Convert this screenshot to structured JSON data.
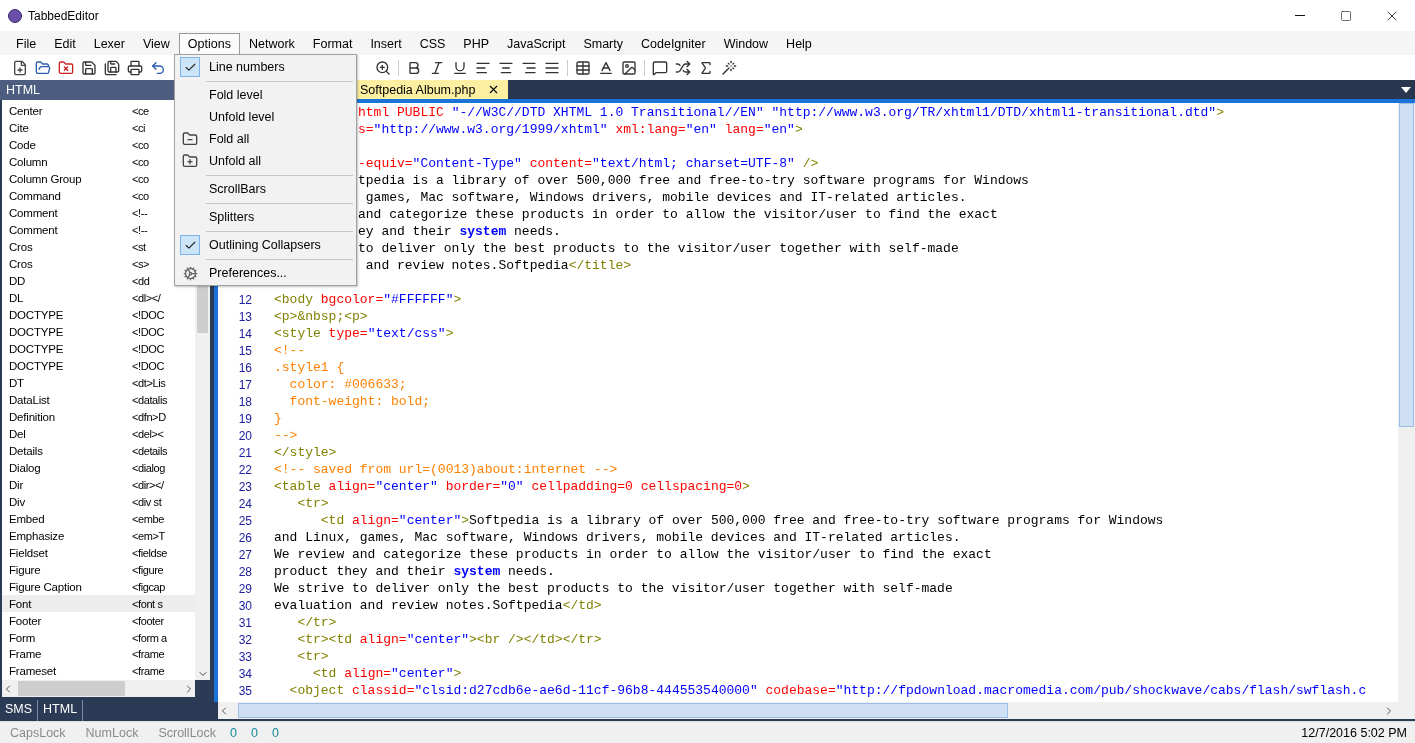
{
  "window": {
    "title": "TabbedEditor"
  },
  "menu_bar": [
    {
      "label": "File",
      "selected": false
    },
    {
      "label": "Edit",
      "selected": false
    },
    {
      "label": "Lexer",
      "selected": false
    },
    {
      "label": "View",
      "selected": false
    },
    {
      "label": "Options",
      "selected": true
    },
    {
      "label": "Network",
      "selected": false
    },
    {
      "label": "Format",
      "selected": false
    },
    {
      "label": "Insert",
      "selected": false
    },
    {
      "label": "CSS",
      "selected": false
    },
    {
      "label": "PHP",
      "selected": false
    },
    {
      "label": "JavaScript",
      "selected": false
    },
    {
      "label": "Smarty",
      "selected": false
    },
    {
      "label": "CodeIgniter",
      "selected": false
    },
    {
      "label": "Window",
      "selected": false
    },
    {
      "label": "Help",
      "selected": false
    }
  ],
  "options_menu": [
    {
      "kind": "check",
      "label": "Line numbers",
      "checked": true
    },
    {
      "kind": "separator"
    },
    {
      "kind": "plain",
      "label": "Fold level"
    },
    {
      "kind": "plain",
      "label": "Unfold level"
    },
    {
      "kind": "fold",
      "label": "Fold all"
    },
    {
      "kind": "unfold",
      "label": "Unfold all"
    },
    {
      "kind": "separator"
    },
    {
      "kind": "check",
      "label": "ScrollBars",
      "checked": false
    },
    {
      "kind": "separator"
    },
    {
      "kind": "check",
      "label": "Splitters",
      "checked": false
    },
    {
      "kind": "separator"
    },
    {
      "kind": "check",
      "label": "Outlining Collapsers",
      "checked": true
    },
    {
      "kind": "separator"
    },
    {
      "kind": "settings",
      "label": "Preferences..."
    }
  ],
  "side_panel": {
    "title": "HTML",
    "items": [
      {
        "name": "Center",
        "snippet": "<ce",
        "selected": false
      },
      {
        "name": "Cite",
        "snippet": "<ci",
        "selected": false
      },
      {
        "name": "Code",
        "snippet": "<co",
        "selected": false
      },
      {
        "name": "Column",
        "snippet": "<co",
        "selected": false
      },
      {
        "name": "Column Group",
        "snippet": "<co",
        "selected": false
      },
      {
        "name": "Command",
        "snippet": "<co",
        "selected": false
      },
      {
        "name": "Comment",
        "snippet": "<!--",
        "selected": false
      },
      {
        "name": "Comment",
        "snippet": "<!--",
        "selected": false
      },
      {
        "name": "Cros",
        "snippet": "<st",
        "selected": false
      },
      {
        "name": "Cros",
        "snippet": "<s>",
        "selected": false
      },
      {
        "name": "DD",
        "snippet": "<dd",
        "selected": false
      },
      {
        "name": "DL",
        "snippet": "<dl></",
        "selected": false
      },
      {
        "name": "DOCTYPE",
        "snippet": "<!DOC",
        "selected": false
      },
      {
        "name": "DOCTYPE",
        "snippet": "<!DOC",
        "selected": false
      },
      {
        "name": "DOCTYPE",
        "snippet": "<!DOC",
        "selected": false
      },
      {
        "name": "DOCTYPE",
        "snippet": "<!DOC",
        "selected": false
      },
      {
        "name": "DT",
        "snippet": "<dt>Lis",
        "selected": false
      },
      {
        "name": "DataList",
        "snippet": "<datalis",
        "selected": false
      },
      {
        "name": "Definition",
        "snippet": "<dfn>D",
        "selected": false
      },
      {
        "name": "Del",
        "snippet": "<del><",
        "selected": false
      },
      {
        "name": "Details",
        "snippet": "<details",
        "selected": false
      },
      {
        "name": "Dialog",
        "snippet": "<dialog",
        "selected": false
      },
      {
        "name": "Dir",
        "snippet": "<dir></",
        "selected": false
      },
      {
        "name": "Div",
        "snippet": "<div st",
        "selected": false
      },
      {
        "name": "Embed",
        "snippet": "<embe",
        "selected": false
      },
      {
        "name": "Emphasize",
        "snippet": "<em>T",
        "selected": false
      },
      {
        "name": "Fieldset",
        "snippet": "<fieldse",
        "selected": false
      },
      {
        "name": "Figure",
        "snippet": "<figure",
        "selected": false
      },
      {
        "name": "Figure Caption",
        "snippet": "<figcap",
        "selected": false
      },
      {
        "name": "Font",
        "snippet": "<font s",
        "selected": true
      },
      {
        "name": "Footer",
        "snippet": "<footer",
        "selected": false
      },
      {
        "name": "Form",
        "snippet": "<form a",
        "selected": false
      },
      {
        "name": "Frame",
        "snippet": "<frame",
        "selected": false
      },
      {
        "name": "Frameset",
        "snippet": "<frame",
        "selected": false
      }
    ],
    "tabs": [
      {
        "label": "SMS"
      },
      {
        "label": "HTML"
      }
    ]
  },
  "editor": {
    "tab": {
      "label": "Softpedia Album.php"
    },
    "lines": [
      {
        "cut_left": true,
        "segments": [
          {
            "kind": "attr",
            "text": "html PUBLIC"
          },
          {
            "kind": "value",
            "text": " \"-//W3C//DTD XHTML 1.0 Transitional//EN\" \"http://www.w3.org/TR/xhtml1/DTD/xhtml1-transitional.dtd\""
          },
          {
            "kind": "tag",
            "text": ">"
          }
        ]
      },
      {
        "cut_left": true,
        "segments": [
          {
            "kind": "attr",
            "text": "s="
          },
          {
            "kind": "value",
            "text": "\"http://www.w3.org/1999/xhtml\""
          },
          {
            "kind": "attr",
            "text": " xml:lang="
          },
          {
            "kind": "value",
            "text": "\"en\""
          },
          {
            "kind": "attr",
            "text": " lang="
          },
          {
            "kind": "value",
            "text": "\"en\""
          },
          {
            "kind": "tag",
            "text": ">"
          }
        ]
      },
      {
        "kind": "blank"
      },
      {
        "cut_left": true,
        "segments": [
          {
            "kind": "attr",
            "text": "-equiv="
          },
          {
            "kind": "value",
            "text": "\"Content-Type\""
          },
          {
            "kind": "attr",
            "text": " content="
          },
          {
            "kind": "value",
            "text": "\"text/html; charset=UTF-8\""
          },
          {
            "kind": "tag",
            "text": " />"
          }
        ]
      },
      {
        "cut_left": true,
        "segments": [
          {
            "kind": "text",
            "text": "tpedia is a library of over 500,000 free and free-to-try software programs for Windows"
          }
        ]
      },
      {
        "cut_left": true,
        "segments": [
          {
            "kind": "text",
            "text": " games, Mac software, Windows drivers, mobile devices and IT-related articles."
          }
        ]
      },
      {
        "cut_left": true,
        "segments": [
          {
            "kind": "text",
            "text": "and categorize these products in order to allow the visitor/user to find the exact"
          }
        ]
      },
      {
        "cut_left": true,
        "segments": [
          {
            "kind": "text",
            "text": "ey and their "
          },
          {
            "kind": "keyword",
            "text": "system"
          },
          {
            "kind": "text",
            "text": " needs."
          }
        ]
      },
      {
        "cut_left": true,
        "segments": [
          {
            "kind": "text",
            "text": "to deliver only the best products to the visitor/user together with self-made"
          }
        ]
      },
      {
        "cut_left": true,
        "segments": [
          {
            "kind": "text",
            "text": " and review notes.Softpedia"
          },
          {
            "kind": "tag",
            "text": "</title>"
          }
        ]
      },
      {
        "kind": "blank"
      },
      {
        "number": "12",
        "segments": [
          {
            "kind": "tag",
            "text": "<body"
          },
          {
            "kind": "attr",
            "text": " bgcolor="
          },
          {
            "kind": "value",
            "text": "\"#FFFFFF\""
          },
          {
            "kind": "tag",
            "text": ">"
          }
        ]
      },
      {
        "number": "13",
        "segments": [
          {
            "kind": "tag",
            "text": "<p>&nbsp;<p>"
          }
        ]
      },
      {
        "number": "14",
        "segments": [
          {
            "kind": "tag",
            "text": "<style"
          },
          {
            "kind": "attr",
            "text": " type="
          },
          {
            "kind": "value",
            "text": "\"text/css\""
          },
          {
            "kind": "tag",
            "text": ">"
          }
        ]
      },
      {
        "number": "15",
        "segments": [
          {
            "kind": "css",
            "text": "<!--"
          }
        ]
      },
      {
        "number": "16",
        "segments": [
          {
            "kind": "css",
            "text": ".style1 {"
          }
        ]
      },
      {
        "number": "17",
        "segments": [
          {
            "kind": "css",
            "text": "  color: #006633;"
          }
        ]
      },
      {
        "number": "18",
        "segments": [
          {
            "kind": "css",
            "text": "  font-weight: bold;"
          }
        ]
      },
      {
        "number": "19",
        "segments": [
          {
            "kind": "css",
            "text": "}"
          }
        ]
      },
      {
        "number": "20",
        "segments": [
          {
            "kind": "css",
            "text": "-->"
          }
        ]
      },
      {
        "number": "21",
        "segments": [
          {
            "kind": "tag",
            "text": "</style>"
          }
        ]
      },
      {
        "number": "22",
        "segments": [
          {
            "kind": "css",
            "text": "<!-- saved from url=(0013)about:internet -->"
          }
        ]
      },
      {
        "number": "23",
        "segments": [
          {
            "kind": "tag",
            "text": "<table"
          },
          {
            "kind": "attr",
            "text": " align="
          },
          {
            "kind": "value",
            "text": "\"center\""
          },
          {
            "kind": "attr",
            "text": " border="
          },
          {
            "kind": "value",
            "text": "\"0\""
          },
          {
            "kind": "attr",
            "text": " cellpadding=0 cellspacing=0"
          },
          {
            "kind": "tag",
            "text": ">"
          }
        ]
      },
      {
        "number": "24",
        "segments": [
          {
            "kind": "tag",
            "text": "   <tr>"
          }
        ]
      },
      {
        "number": "25",
        "segments": [
          {
            "kind": "tag",
            "text": "      <td"
          },
          {
            "kind": "attr",
            "text": " align="
          },
          {
            "kind": "value",
            "text": "\"center\""
          },
          {
            "kind": "tag",
            "text": ">"
          },
          {
            "kind": "text",
            "text": "Softpedia is a library of over 500,000 free and free-to-try software programs for Windows"
          }
        ]
      },
      {
        "number": "26",
        "segments": [
          {
            "kind": "text",
            "text": "and Linux, games, Mac software, Windows drivers, mobile devices and IT-related articles."
          }
        ]
      },
      {
        "number": "27",
        "segments": [
          {
            "kind": "text",
            "text": "We review and categorize these products in order to allow the visitor/user to find the exact"
          }
        ]
      },
      {
        "number": "28",
        "segments": [
          {
            "kind": "text",
            "text": "product they and their "
          },
          {
            "kind": "keyword",
            "text": "system"
          },
          {
            "kind": "text",
            "text": " needs."
          }
        ]
      },
      {
        "number": "29",
        "segments": [
          {
            "kind": "text",
            "text": "We strive to deliver only the best products to the visitor/user together with self-made"
          }
        ]
      },
      {
        "number": "30",
        "segments": [
          {
            "kind": "text",
            "text": "evaluation and review notes.Softpedia"
          },
          {
            "kind": "tag",
            "text": "</td>"
          }
        ]
      },
      {
        "number": "31",
        "segments": [
          {
            "kind": "tag",
            "text": "   </tr>"
          }
        ]
      },
      {
        "number": "32",
        "segments": [
          {
            "kind": "tag",
            "text": "   <tr><td"
          },
          {
            "kind": "attr",
            "text": " align="
          },
          {
            "kind": "value",
            "text": "\"center\""
          },
          {
            "kind": "tag",
            "text": "><br /></td></tr>"
          }
        ]
      },
      {
        "number": "33",
        "segments": [
          {
            "kind": "tag",
            "text": "   <tr>"
          }
        ]
      },
      {
        "number": "34",
        "segments": [
          {
            "kind": "tag",
            "text": "     <td"
          },
          {
            "kind": "attr",
            "text": " align="
          },
          {
            "kind": "value",
            "text": "\"center\""
          },
          {
            "kind": "tag",
            "text": ">"
          }
        ]
      },
      {
        "number": "35",
        "segments": [
          {
            "kind": "tag",
            "text": "  <object"
          },
          {
            "kind": "attr",
            "text": " classid="
          },
          {
            "kind": "value",
            "text": "\"clsid:d27cdb6e-ae6d-11cf-96b8-444553540000\""
          },
          {
            "kind": "attr",
            "text": " codebase="
          },
          {
            "kind": "value",
            "text": "\"http://fpdownload.macromedia.com/pub/shockwave/cabs/flash/swflash.c"
          }
        ]
      }
    ]
  },
  "status_bar": {
    "keys": [
      "CapsLock",
      "NumLock",
      "ScrollLock"
    ],
    "counters": [
      "0",
      "0",
      "0"
    ],
    "datetime": "12/7/2016 5:02 PM"
  }
}
